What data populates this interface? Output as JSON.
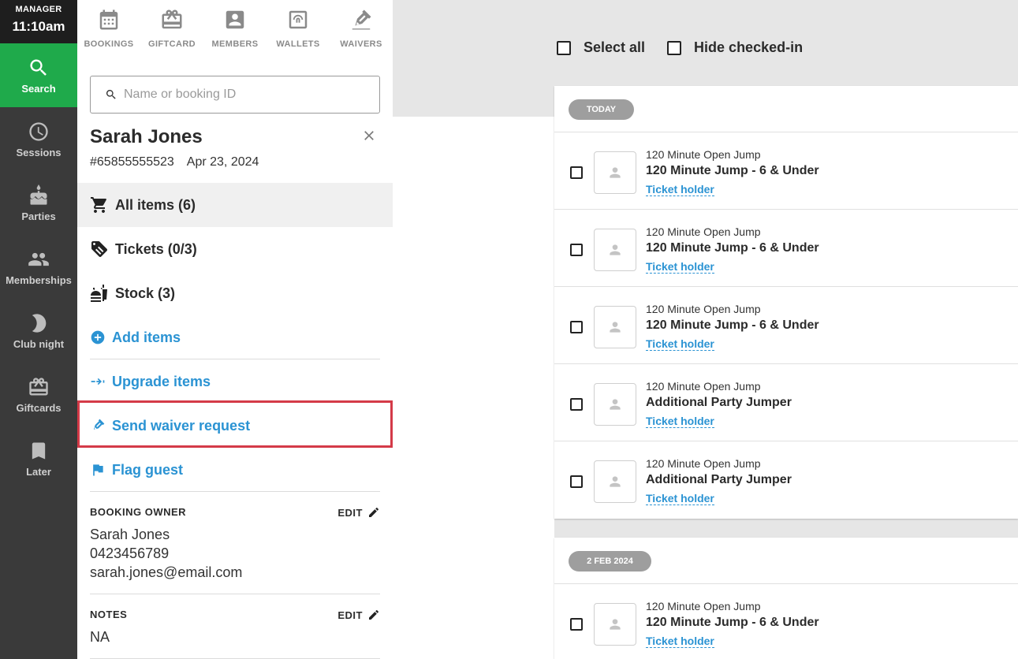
{
  "nav": {
    "role": "MANAGER",
    "time": "11:10am",
    "items": [
      {
        "label": "Search",
        "icon": "search-icon",
        "active": true
      },
      {
        "label": "Sessions",
        "icon": "clock-icon"
      },
      {
        "label": "Parties",
        "icon": "cake-icon"
      },
      {
        "label": "Memberships",
        "icon": "people-icon"
      },
      {
        "label": "Club night",
        "icon": "moon-icon"
      },
      {
        "label": "Giftcards",
        "icon": "gift-icon"
      },
      {
        "label": "Later",
        "icon": "bookmark-icon"
      }
    ]
  },
  "top_tabs": [
    {
      "label": "BOOKINGS",
      "icon": "calendar-icon"
    },
    {
      "label": "GIFTCARD",
      "icon": "gift-icon"
    },
    {
      "label": "MEMBERS",
      "icon": "member-card-icon"
    },
    {
      "label": "WALLETS",
      "icon": "wallet-icon"
    },
    {
      "label": "WAIVERS",
      "icon": "pen-icon"
    }
  ],
  "search": {
    "placeholder": "Name or booking ID",
    "value": ""
  },
  "booking": {
    "name": "Sarah Jones",
    "id": "#65855555523",
    "date": "Apr 23, 2024"
  },
  "categories": [
    {
      "label": "All items (6)",
      "icon": "cart-icon",
      "active": true
    },
    {
      "label": "Tickets (0/3)",
      "icon": "ticket-icon"
    },
    {
      "label": "Stock (3)",
      "icon": "food-icon"
    }
  ],
  "actions": [
    {
      "label": "Add items",
      "icon": "add-circle-icon"
    },
    {
      "label": "Upgrade items",
      "icon": "upgrade-icon"
    },
    {
      "label": "Send waiver request",
      "icon": "pen-icon"
    },
    {
      "label": "Flag guest",
      "icon": "flag-icon"
    }
  ],
  "owner": {
    "heading": "BOOKING OWNER",
    "edit": "EDIT",
    "name": "Sarah Jones",
    "phone": "0423456789",
    "email": "sarah.jones@email.com"
  },
  "notes": {
    "heading": "NOTES",
    "edit": "EDIT",
    "value": "NA"
  },
  "toolbar": {
    "select_all": "Select all",
    "hide_checked_in": "Hide checked-in"
  },
  "groups": [
    {
      "date": "TODAY",
      "rows": [
        {
          "session": "120 Minute Open Jump",
          "ticket": "120 Minute Jump - 6 & Under",
          "holder": "Ticket holder"
        },
        {
          "session": "120 Minute Open Jump",
          "ticket": "120 Minute Jump - 6 & Under",
          "holder": "Ticket holder"
        },
        {
          "session": "120 Minute Open Jump",
          "ticket": "120 Minute Jump - 6 & Under",
          "holder": "Ticket holder"
        },
        {
          "session": "120 Minute Open Jump",
          "ticket": "Additional Party Jumper",
          "holder": "Ticket holder"
        },
        {
          "session": "120 Minute Open Jump",
          "ticket": "Additional Party Jumper",
          "holder": "Ticket holder"
        }
      ]
    },
    {
      "date": "2 FEB 2024",
      "rows": [
        {
          "session": "120 Minute Open Jump",
          "ticket": "120 Minute Jump - 6 & Under",
          "holder": "Ticket holder"
        }
      ]
    }
  ],
  "colors": {
    "active_nav": "#1faa4b",
    "link": "#2b93d3",
    "highlight": "#d43a48"
  }
}
